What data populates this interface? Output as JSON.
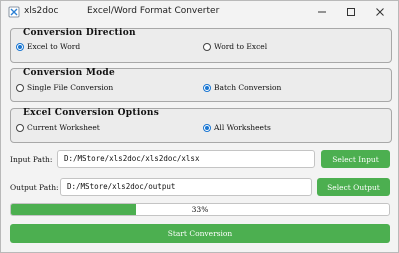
{
  "titlebar": {
    "app_name": "xls2doc",
    "title": "Excel/Word Format Converter"
  },
  "direction": {
    "title": "Conversion Direction",
    "options": [
      {
        "label": "Excel to Word",
        "selected": true
      },
      {
        "label": "Word to Excel",
        "selected": false
      }
    ]
  },
  "mode": {
    "title": "Conversion Mode",
    "options": [
      {
        "label": "Single File Conversion",
        "selected": false
      },
      {
        "label": "Batch Conversion",
        "selected": true
      }
    ]
  },
  "excel_options": {
    "title": "Excel Conversion Options",
    "options": [
      {
        "label": "Current Worksheet",
        "selected": false
      },
      {
        "label": "All Worksheets",
        "selected": true
      }
    ]
  },
  "input": {
    "label": "Input Path:",
    "value": "D:/MStore/xls2doc/xls2doc/xlsx",
    "button": "Select Input"
  },
  "output": {
    "label": "Output Path:",
    "value": "D:/MStore/xls2doc/output",
    "button": "Select Output"
  },
  "progress": {
    "value": 0.33,
    "text": "33%"
  },
  "start_button": "Start Conversion",
  "colors": {
    "accent_green": "#4caf50",
    "radio_blue": "#1976d2"
  },
  "icons": {
    "app": "xls2doc-app-icon",
    "minimize": "minimize-icon",
    "maximize": "maximize-icon",
    "close": "close-icon"
  }
}
